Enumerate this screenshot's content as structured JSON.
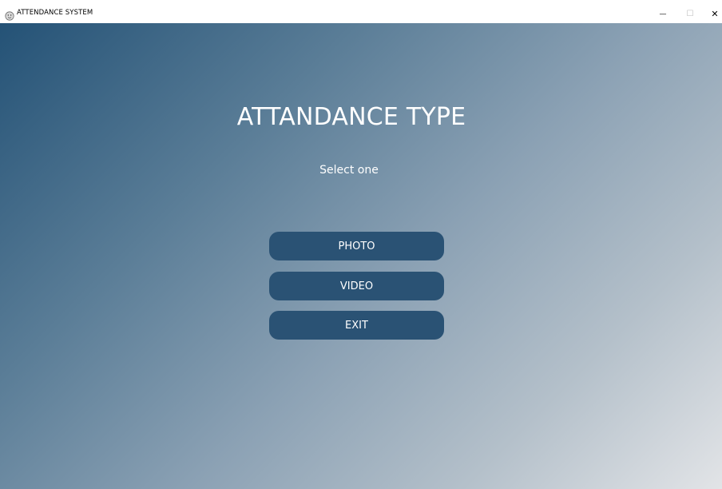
{
  "window": {
    "title": "ATTENDANCE SYSTEM",
    "icon": "face-icon",
    "controls": {
      "minimize_icon": "minimize-icon",
      "maximize_icon": "maximize-icon",
      "close_icon": "close-icon",
      "minimize_glyph": "—",
      "maximize_glyph": "☐",
      "close_glyph": "✕"
    }
  },
  "main": {
    "title": "ATTANDANCE TYPE",
    "subtitle": "Select one",
    "buttons": [
      {
        "label": "PHOTO"
      },
      {
        "label": "VIDEO"
      },
      {
        "label": "EXIT"
      }
    ]
  },
  "colors": {
    "button_bg": "#2a5274",
    "gradient_start": "#245276",
    "gradient_end": "#e2e4e7",
    "text": "#ffffff"
  }
}
